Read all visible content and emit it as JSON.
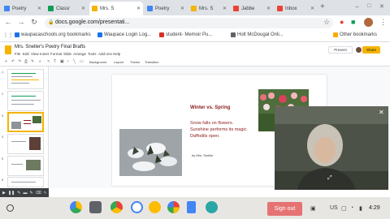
{
  "browser": {
    "tabs": [
      {
        "label": "Poetry",
        "color": "#4285f4"
      },
      {
        "label": "Classr",
        "color": "#0f9d58"
      },
      {
        "label": "Mrs. S",
        "color": "#f4b400"
      },
      {
        "label": "Poetry",
        "color": "#4285f4"
      },
      {
        "label": "Mrs. S",
        "color": "#f4b400"
      },
      {
        "label": "Jabbe",
        "color": "#ea4335"
      },
      {
        "label": "Inbox",
        "color": "#ea4335"
      }
    ],
    "url": "docs.google.com/presentati...",
    "bookmarks": [
      {
        "label": "waupacaschools.org bookmarks",
        "color": "#1a73e8"
      },
      {
        "label": "Waupace Login Log...",
        "color": "#1a73e8"
      },
      {
        "label": "student- Memoir Pu...",
        "color": "#d93025"
      },
      {
        "label": "Holt McDougal Onli...",
        "color": "#5f6368"
      }
    ],
    "other_bookmarks": "Other bookmarks"
  },
  "slides_app": {
    "title": "Mrs. Sneller's Poetry Final Brafts",
    "menu": [
      "File",
      "Edit",
      "View",
      "Insert",
      "Format",
      "Slide",
      "Arrange",
      "Tools",
      "Add-ons",
      "Help"
    ],
    "toolbar_text": [
      "Background",
      "Layout",
      "Theme",
      "Transition"
    ],
    "present_label": "Present",
    "share_label": "Share"
  },
  "slide": {
    "title": "Winter vs. Spring",
    "lines": [
      "Snow falls on flowers.",
      "Sunshine performs its magic.",
      "Daffodils open."
    ],
    "byline": "by Mrs. Sneller"
  },
  "filmstrip": {
    "numbers": [
      "1",
      "2",
      "3",
      "4",
      "5",
      "6"
    ]
  },
  "shelf": {
    "sign_out": "Sign out",
    "locale": "US",
    "time": "4:29"
  },
  "colors": {
    "accent": "#f4b400",
    "poem_text": "#8b1a1a",
    "sign_out_bg": "#e57373"
  }
}
